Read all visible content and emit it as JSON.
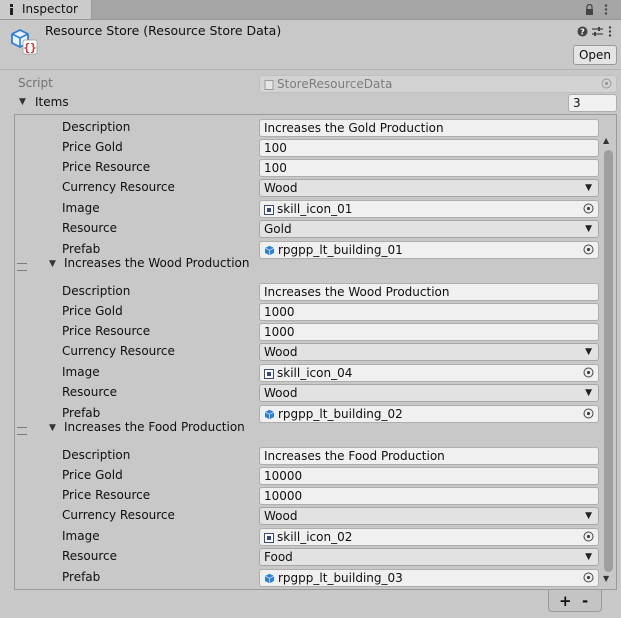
{
  "tab": {
    "label": "Inspector"
  },
  "header": {
    "title": "Resource Store (Resource Store Data)",
    "open_label": "Open"
  },
  "script_row": {
    "label": "Script",
    "value": "StoreResourceData"
  },
  "items": {
    "label": "Items",
    "count": "3"
  },
  "field_labels": {
    "description": "Description",
    "price_gold": "Price Gold",
    "price_resource": "Price Resource",
    "currency_resource": "Currency Resource",
    "image": "Image",
    "resource": "Resource",
    "prefab": "Prefab"
  },
  "elements": [
    {
      "title": "Increases the Gold Production",
      "description": "Increases the Gold Production",
      "price_gold": "100",
      "price_resource": "100",
      "currency_resource": "Wood",
      "image": "skill_icon_01",
      "resource": "Gold",
      "prefab": "rpgpp_lt_building_01"
    },
    {
      "title": "Increases the Wood Production",
      "description": "Increases the Wood Production",
      "price_gold": "1000",
      "price_resource": "1000",
      "currency_resource": "Wood",
      "image": "skill_icon_04",
      "resource": "Wood",
      "prefab": "rpgpp_lt_building_02"
    },
    {
      "title": "Increases the Food Production",
      "description": "Increases the Food Production",
      "price_gold": "10000",
      "price_resource": "10000",
      "currency_resource": "Wood",
      "image": "skill_icon_02",
      "resource": "Food",
      "prefab": "rpgpp_lt_building_03"
    }
  ],
  "footer": {
    "add_label": "+",
    "remove_label": "-"
  },
  "icons": {
    "lock": "lock-icon",
    "menu": "kebab-menu-icon",
    "help": "help-icon",
    "settings": "preset-sliders-icon"
  },
  "colors": {
    "panel_bg": "#c8c8c8",
    "field_bg": "#f0f0f0",
    "prefab_blue": "#2f7fd3",
    "script_icon_red": "#d42b2b"
  }
}
